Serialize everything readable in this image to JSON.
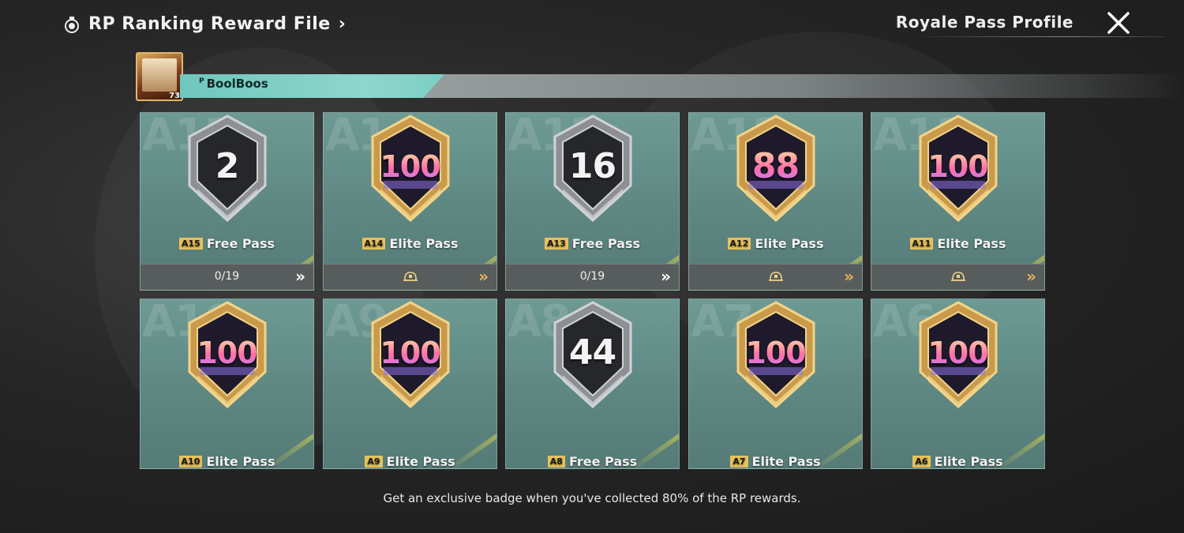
{
  "header": {
    "title": "RP Ranking Reward File",
    "title_icon": "medal-icon",
    "chevron": "›",
    "profile_link": "Royale Pass Profile",
    "close_icon": "close-icon"
  },
  "profile": {
    "name_prefix": "P",
    "name": "BoolBoos",
    "level": "73"
  },
  "colors": {
    "card_teal": "#6e9a94",
    "gold": "#e8c35c",
    "footer_bar": "#575c5c"
  },
  "cards": [
    {
      "season_bg": "A15",
      "badge_type": "free",
      "badge_value": "2",
      "season_tag": "A15",
      "pass": "Free Pass",
      "footer": "0/19",
      "footer_type": "progress"
    },
    {
      "season_bg": "A14",
      "badge_type": "elite",
      "badge_value": "100",
      "season_tag": "A14",
      "pass": "Elite Pass",
      "footer": "",
      "footer_type": "icon"
    },
    {
      "season_bg": "A13",
      "badge_type": "free",
      "badge_value": "16",
      "season_tag": "A13",
      "pass": "Free Pass",
      "footer": "0/19",
      "footer_type": "progress"
    },
    {
      "season_bg": "A12",
      "badge_type": "elite",
      "badge_value": "88",
      "season_tag": "A12",
      "pass": "Elite Pass",
      "footer": "",
      "footer_type": "icon"
    },
    {
      "season_bg": "A11",
      "badge_type": "elite",
      "badge_value": "100",
      "season_tag": "A11",
      "pass": "Elite Pass",
      "footer": "",
      "footer_type": "icon"
    },
    {
      "season_bg": "A10",
      "badge_type": "elite",
      "badge_value": "100",
      "season_tag": "A10",
      "pass": "Elite Pass"
    },
    {
      "season_bg": "A9",
      "badge_type": "elite",
      "badge_value": "100",
      "season_tag": "A9",
      "pass": "Elite Pass"
    },
    {
      "season_bg": "A8",
      "badge_type": "free",
      "badge_value": "44",
      "season_tag": "A8",
      "pass": "Free Pass"
    },
    {
      "season_bg": "A7",
      "badge_type": "elite",
      "badge_value": "100",
      "season_tag": "A7",
      "pass": "Elite Pass"
    },
    {
      "season_bg": "A6",
      "badge_type": "elite",
      "badge_value": "100",
      "season_tag": "A6",
      "pass": "Elite Pass"
    }
  ],
  "footer_note": "Get an exclusive badge when you've collected 80% of the RP rewards."
}
